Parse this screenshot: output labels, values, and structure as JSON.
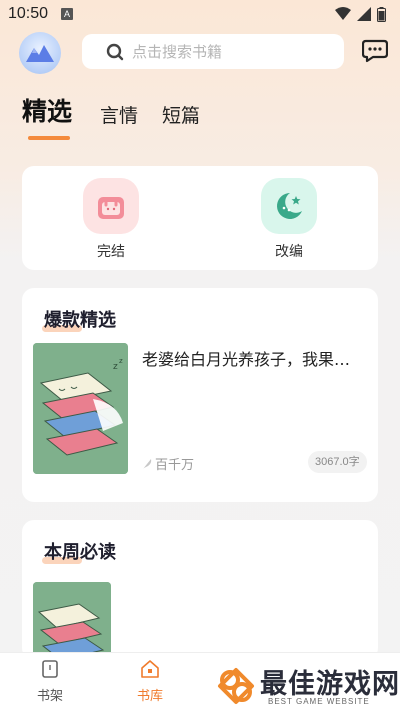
{
  "status_bar": {
    "time": "10:50",
    "notification_icon": "A"
  },
  "header": {
    "logo_icon": "mountain-logo-icon",
    "search_placeholder": "点击搜索书籍",
    "message_icon": "chat-bubble-icon"
  },
  "tabs": [
    {
      "label": "精选",
      "active": true
    },
    {
      "label": "言情",
      "active": false
    },
    {
      "label": "短篇",
      "active": false
    }
  ],
  "categories": [
    {
      "label": "完结",
      "icon": "rabbit-box-icon",
      "color": "#fde3e3"
    },
    {
      "label": "改编",
      "icon": "moon-star-icon",
      "color": "#d9f6ec"
    }
  ],
  "sections": [
    {
      "title": "爆款精选",
      "book": {
        "title": "老婆给白月光养孩子，我果断离婚",
        "author": "百千万",
        "words": "3067.0字"
      }
    },
    {
      "title": "本周必读"
    }
  ],
  "bottom_nav": [
    {
      "label": "书架",
      "icon": "bookshelf-icon",
      "active": false
    },
    {
      "label": "书库",
      "icon": "library-home-icon",
      "active": true
    }
  ],
  "watermark": {
    "text": "最佳游戏网",
    "subtext": "BEST GAME WEBSITE"
  },
  "colors": {
    "accent": "#f07b2c",
    "tab_underline": "#f48a3c",
    "cover_green": "#7fb08c"
  }
}
